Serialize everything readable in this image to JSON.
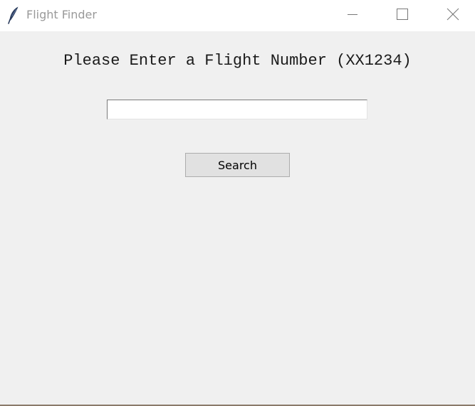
{
  "window": {
    "title": "Flight Finder",
    "icon": "feather-icon",
    "controls": [
      "minimize-icon",
      "maximize-icon",
      "close-icon"
    ]
  },
  "form": {
    "prompt": "Please Enter a Flight Number (XX1234)",
    "flight_number_value": "",
    "search_label": "Search"
  }
}
